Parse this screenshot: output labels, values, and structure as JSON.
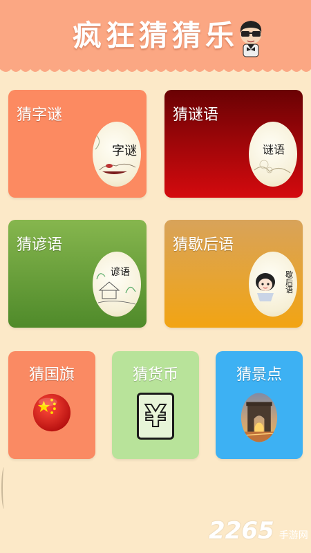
{
  "header": {
    "title": "疯狂猜猜乐"
  },
  "cards": {
    "zimi": {
      "label": "猜字谜",
      "image_text": "字谜",
      "color": "#fc8a61"
    },
    "miyu": {
      "label": "猜谜语",
      "image_text": "谜语",
      "color": "#b5060b"
    },
    "yanyu": {
      "label": "猜谚语",
      "image_text": "谚语",
      "color": "#6ea43b"
    },
    "xiehouyu": {
      "label": "猜歇后语",
      "image_text": "歇后语",
      "color": "#eba135"
    },
    "guoqi": {
      "label": "猜国旗",
      "color": "#fa8a63"
    },
    "huobi": {
      "label": "猜货币",
      "image_text": "¥",
      "color": "#b8e39a"
    },
    "jingdian": {
      "label": "猜景点",
      "color": "#3db1f3"
    }
  },
  "watermark": {
    "number": "2265",
    "text": "手游网"
  }
}
